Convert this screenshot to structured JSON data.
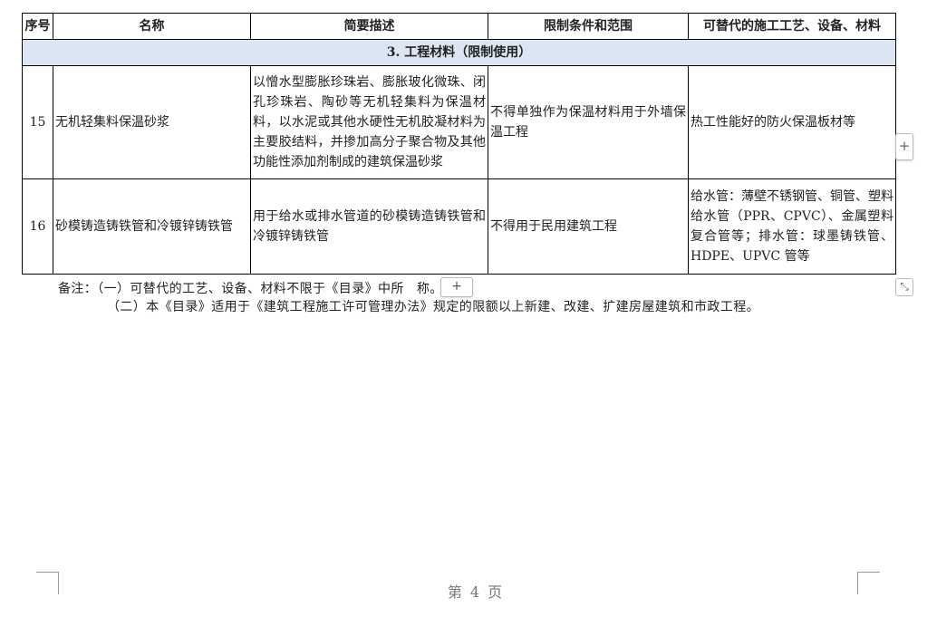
{
  "table": {
    "headers": [
      "序号",
      "名称",
      "简要描述",
      "限制条件和范围",
      "可替代的施工工艺、设备、材料"
    ],
    "section_title": "3. 工程材料（限制使用）",
    "rows": [
      {
        "no": "15",
        "name": "无机轻集料保温砂浆",
        "description": "以憎水型膨胀珍珠岩、膨胀玻化微珠、闭孔珍珠岩、陶砂等无机轻集料为保温材料，以水泥或其他水硬性无机胶凝材料为主要胶结料，并掺加高分子聚合物及其他功能性添加剂制成的建筑保温砂浆",
        "restriction": "不得单独作为保温材料用于外墙保温工程",
        "alternative": "热工性能好的防火保温板材等"
      },
      {
        "no": "16",
        "name": "砂模铸造铸铁管和冷镀锌铸铁管",
        "description": "用于给水或排水管道的砂模铸造铸铁管和冷镀锌铸铁管",
        "restriction": "不得用于民用建筑工程",
        "alternative": "给水管：薄壁不锈钢管、铜管、塑料给水管（PPR、CPVC）、金属塑料复合管等；排水管：球墨铸铁管、HDPE、UPVC 管等"
      }
    ]
  },
  "notes": {
    "note1_before": "备注：（一）可替代的工艺、设备、材料不限于《目录》中所",
    "note1_after": "称。",
    "note2": "（二）本《目录》适用于《建筑工程施工许可管理办法》规定的限额以上新建、改建、扩建房屋建筑和市政工程。"
  },
  "controls": {
    "add_column_glyph": "+",
    "add_row_glyph": "+",
    "resize_glyph": "⤡"
  },
  "footer": {
    "page_label": "第 4 页"
  }
}
